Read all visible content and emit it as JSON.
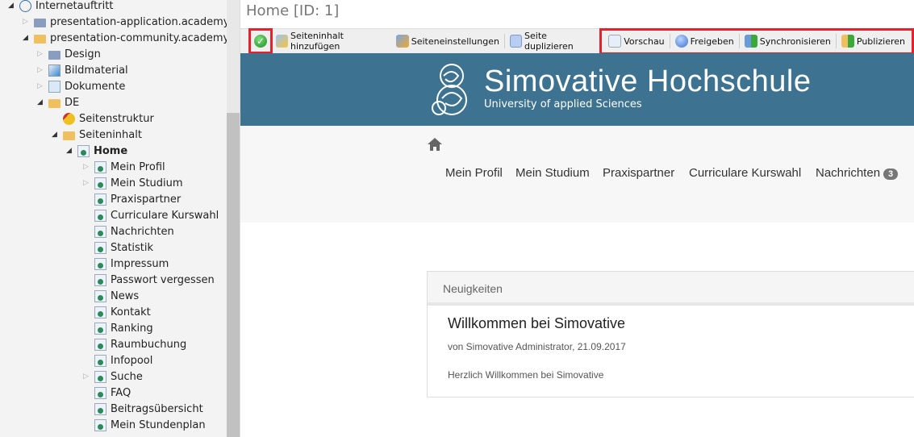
{
  "tree": [
    {
      "label": "Internetauftritt",
      "level": 0,
      "arrow": "open",
      "icon": "globe-icon"
    },
    {
      "label": "presentation-application.academyfive",
      "level": 1,
      "arrow": "closed",
      "icon": "folder-icon"
    },
    {
      "label": "presentation-community.academyfive",
      "level": 1,
      "arrow": "open",
      "icon": "folder-open-icon"
    },
    {
      "label": "Design",
      "level": 2,
      "arrow": "closed",
      "icon": "folder-icon"
    },
    {
      "label": "Bildmaterial",
      "level": 2,
      "arrow": "closed",
      "icon": "image-icon"
    },
    {
      "label": "Dokumente",
      "level": 2,
      "arrow": "closed",
      "icon": "documents-icon"
    },
    {
      "label": "DE",
      "level": 2,
      "arrow": "open",
      "icon": "folder-open-icon"
    },
    {
      "label": "Seitenstruktur",
      "level": 3,
      "arrow": "none",
      "icon": "key-icon"
    },
    {
      "label": "Seiteninhalt",
      "level": 3,
      "arrow": "open",
      "icon": "folder-open-icon"
    },
    {
      "label": "Home",
      "level": 4,
      "arrow": "open",
      "icon": "page-icon",
      "bold": true
    },
    {
      "label": "Mein Profil",
      "level": 5,
      "arrow": "closed",
      "icon": "page-icon"
    },
    {
      "label": "Mein Studium",
      "level": 5,
      "arrow": "closed",
      "icon": "page-icon"
    },
    {
      "label": "Praxispartner",
      "level": 5,
      "arrow": "none",
      "icon": "page-icon"
    },
    {
      "label": "Curriculare Kurswahl",
      "level": 5,
      "arrow": "none",
      "icon": "page-icon"
    },
    {
      "label": "Nachrichten",
      "level": 5,
      "arrow": "none",
      "icon": "page-icon"
    },
    {
      "label": "Statistik",
      "level": 5,
      "arrow": "none",
      "icon": "page-icon"
    },
    {
      "label": "Impressum",
      "level": 5,
      "arrow": "none",
      "icon": "page-icon"
    },
    {
      "label": "Passwort vergessen",
      "level": 5,
      "arrow": "none",
      "icon": "page-icon"
    },
    {
      "label": "News",
      "level": 5,
      "arrow": "none",
      "icon": "page-icon"
    },
    {
      "label": "Kontakt",
      "level": 5,
      "arrow": "none",
      "icon": "page-icon"
    },
    {
      "label": "Ranking",
      "level": 5,
      "arrow": "none",
      "icon": "page-icon"
    },
    {
      "label": "Raumbuchung",
      "level": 5,
      "arrow": "none",
      "icon": "page-icon"
    },
    {
      "label": "Infopool",
      "level": 5,
      "arrow": "none",
      "icon": "page-icon"
    },
    {
      "label": "Suche",
      "level": 5,
      "arrow": "closed",
      "icon": "page-icon"
    },
    {
      "label": "FAQ",
      "level": 5,
      "arrow": "none",
      "icon": "page-icon"
    },
    {
      "label": "Beitragsübersicht",
      "level": 5,
      "arrow": "none",
      "icon": "page-icon"
    },
    {
      "label": "Mein Stundenplan",
      "level": 5,
      "arrow": "none",
      "icon": "page-icon"
    }
  ],
  "header": {
    "title": "Home [ID: 1]"
  },
  "toolbar": {
    "confirm_icon": "check-circle-icon",
    "add_content": "Seiteninhalt hinzufügen",
    "settings": "Seiteneinstellungen",
    "duplicate": "Seite duplizieren",
    "preview": "Vorschau",
    "approve": "Freigeben",
    "sync": "Synchronisieren",
    "publish": "Publizieren",
    "highlight_color": "#e8202a"
  },
  "site": {
    "brand": "Simovative Hochschule",
    "subtitle": "University of applied Sciences",
    "banner_color": "#3d7290",
    "nav": [
      "Mein Profil",
      "Mein Studium",
      "Praxispartner",
      "Curriculare Kurswahl",
      "Nachrichten"
    ],
    "nav_badge": "3"
  },
  "news": {
    "header": "Neuigkeiten",
    "title": "Willkommen bei Simovative",
    "meta": "von Simovative Administrator, 21.09.2017",
    "body": "Herzlich Willkommen bei Simovative"
  }
}
